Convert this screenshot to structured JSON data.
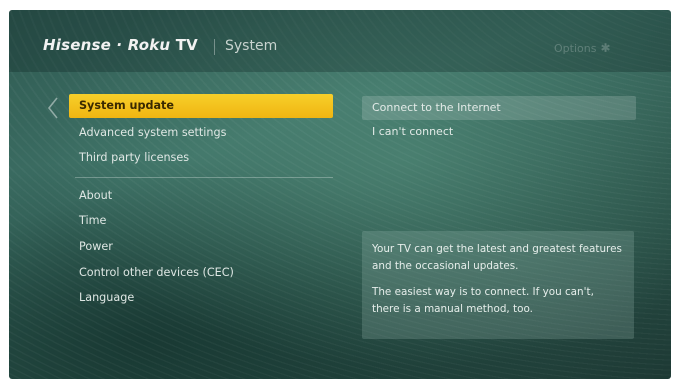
{
  "header": {
    "brand_main": "Hisense · Roku",
    "brand_tv": "TV",
    "title": "System",
    "options_label": "Options",
    "options_icon": "asterisk-icon"
  },
  "menu": {
    "items": [
      {
        "label": "System update",
        "selected": true
      },
      {
        "label": "Advanced system settings"
      },
      {
        "label": "Third party licenses"
      }
    ],
    "items_below": [
      {
        "label": "About"
      },
      {
        "label": "Time"
      },
      {
        "label": "Power"
      },
      {
        "label": "Control other devices (CEC)"
      },
      {
        "label": "Language"
      }
    ]
  },
  "submenu": {
    "items": [
      {
        "label": "Connect to the Internet"
      },
      {
        "label": "I can't connect"
      }
    ]
  },
  "info": {
    "paragraph1": "Your TV can get the latest and greatest features and the occasional updates.",
    "paragraph2": "The easiest way is to connect.  If you can't, there is a manual method, too."
  },
  "colors": {
    "accent_yellow": "#f5c518",
    "background_teal": "#2f5a52"
  }
}
